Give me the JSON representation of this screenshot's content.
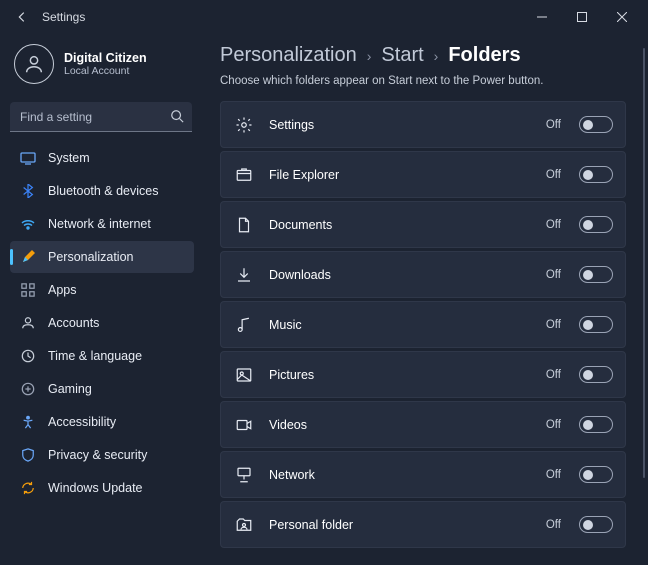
{
  "window": {
    "title": "Settings"
  },
  "profile": {
    "name": "Digital Citizen",
    "sub": "Local Account"
  },
  "search": {
    "placeholder": "Find a setting"
  },
  "nav": {
    "items": [
      {
        "label": "System"
      },
      {
        "label": "Bluetooth & devices"
      },
      {
        "label": "Network & internet"
      },
      {
        "label": "Personalization"
      },
      {
        "label": "Apps"
      },
      {
        "label": "Accounts"
      },
      {
        "label": "Time & language"
      },
      {
        "label": "Gaming"
      },
      {
        "label": "Accessibility"
      },
      {
        "label": "Privacy & security"
      },
      {
        "label": "Windows Update"
      }
    ]
  },
  "breadcrumb": {
    "a": "Personalization",
    "b": "Start",
    "c": "Folders"
  },
  "description": "Choose which folders appear on Start next to the Power button.",
  "folders": {
    "items": [
      {
        "label": "Settings",
        "state": "Off"
      },
      {
        "label": "File Explorer",
        "state": "Off"
      },
      {
        "label": "Documents",
        "state": "Off"
      },
      {
        "label": "Downloads",
        "state": "Off"
      },
      {
        "label": "Music",
        "state": "Off"
      },
      {
        "label": "Pictures",
        "state": "Off"
      },
      {
        "label": "Videos",
        "state": "Off"
      },
      {
        "label": "Network",
        "state": "Off"
      },
      {
        "label": "Personal folder",
        "state": "Off"
      }
    ]
  }
}
